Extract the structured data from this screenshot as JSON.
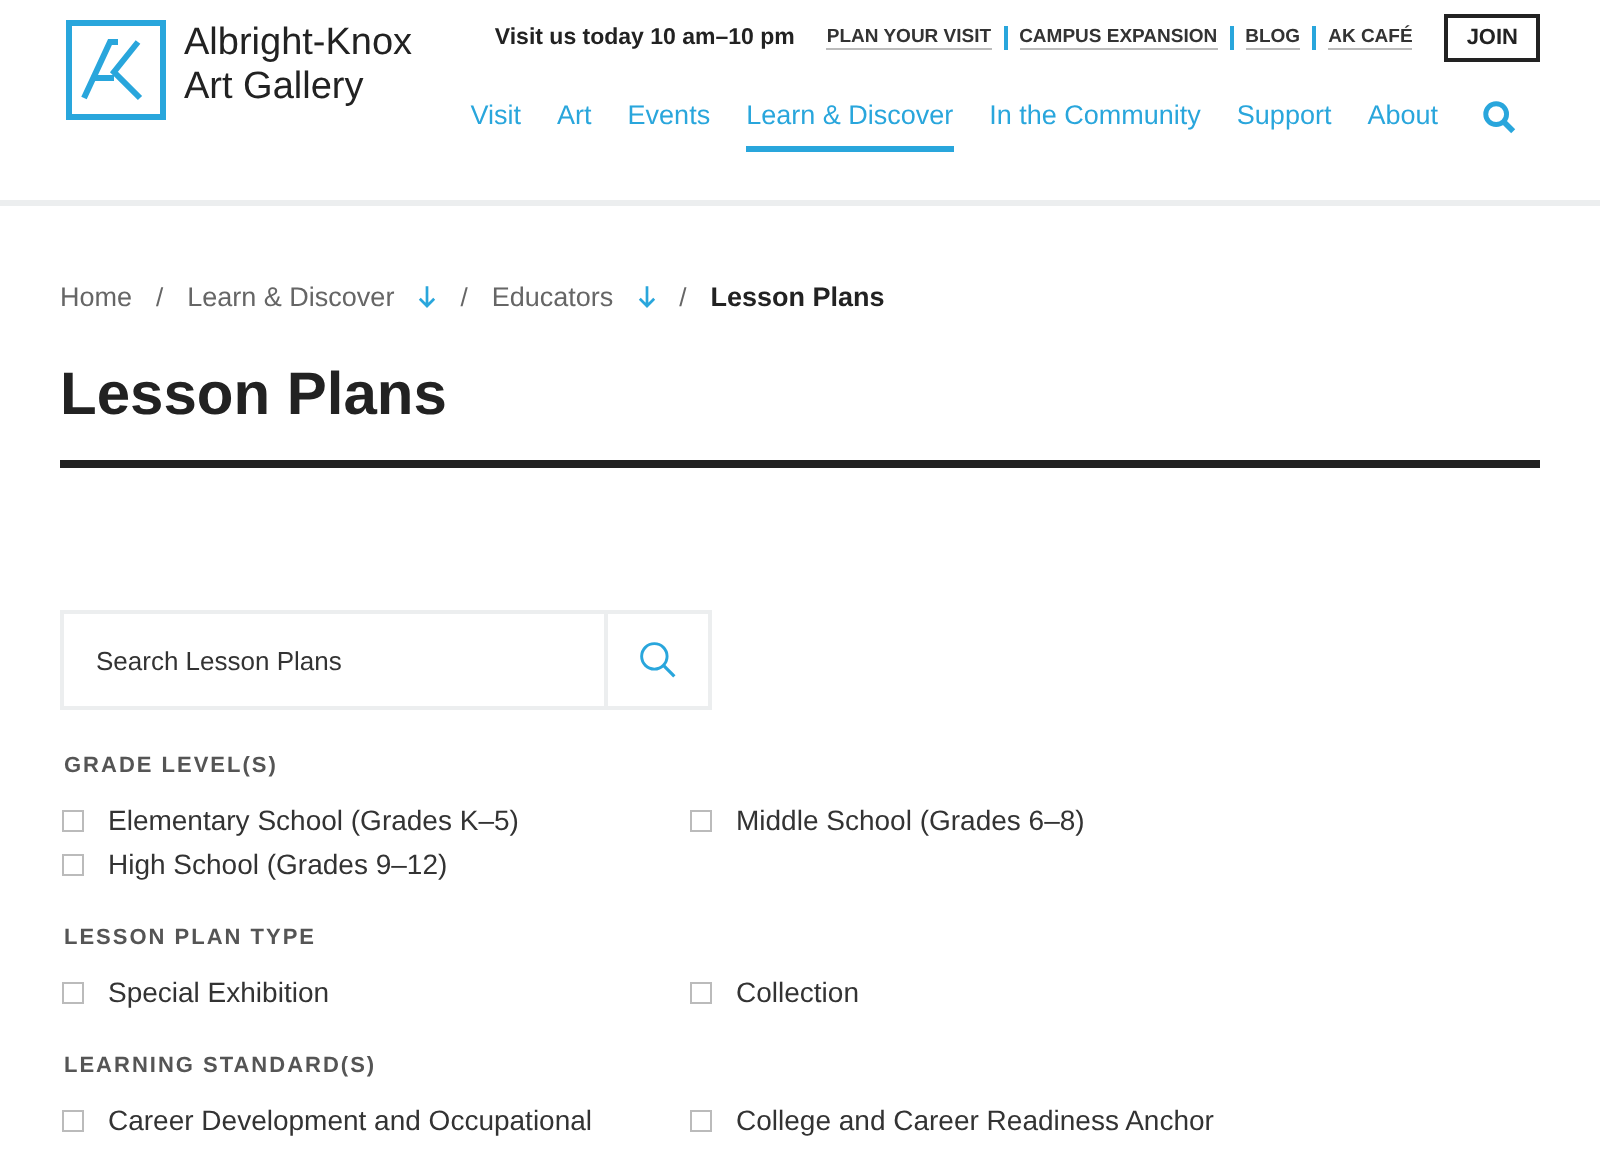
{
  "logo": {
    "line_1": "Albright-Knox",
    "line_2": "Art Gallery"
  },
  "hours": "Visit us today 10 am–10 pm",
  "utility_links": [
    "PLAN YOUR VISIT",
    "CAMPUS EXPANSION",
    "BLOG",
    "AK CAFÉ"
  ],
  "join_button": "JOIN",
  "nav": [
    {
      "label": "Visit",
      "selected": false
    },
    {
      "label": "Art",
      "selected": false
    },
    {
      "label": "Events",
      "selected": false
    },
    {
      "label": "Learn & Discover",
      "selected": true
    },
    {
      "label": "In the Community",
      "selected": false
    },
    {
      "label": "Support",
      "selected": false
    },
    {
      "label": "About",
      "selected": false
    }
  ],
  "breadcrumbs": [
    {
      "label": "Home",
      "dropdown": false,
      "current": false
    },
    {
      "label": "Learn & Discover",
      "dropdown": true,
      "current": false
    },
    {
      "label": "Educators",
      "dropdown": true,
      "current": false
    },
    {
      "label": "Lesson Plans",
      "dropdown": false,
      "current": true
    }
  ],
  "breadcrumb_separator": "/",
  "page_title": "Lesson Plans",
  "search": {
    "placeholder": "Search Lesson Plans"
  },
  "filters": [
    {
      "heading": "GRADE LEVEL(S)",
      "options": [
        {
          "label": "Elementary School (Grades K–5)",
          "checked": false
        },
        {
          "label": "Middle School (Grades 6–8)",
          "checked": false
        },
        {
          "label": "High School (Grades 9–12)",
          "checked": false
        }
      ]
    },
    {
      "heading": "LESSON PLAN TYPE",
      "options": [
        {
          "label": "Special Exhibition",
          "checked": false
        },
        {
          "label": "Collection",
          "checked": false
        }
      ]
    },
    {
      "heading": "LEARNING STANDARD(S)",
      "options": [
        {
          "label": "Career Development and Occupational",
          "checked": false
        },
        {
          "label": "College and Career Readiness Anchor",
          "checked": false
        }
      ]
    }
  ]
}
